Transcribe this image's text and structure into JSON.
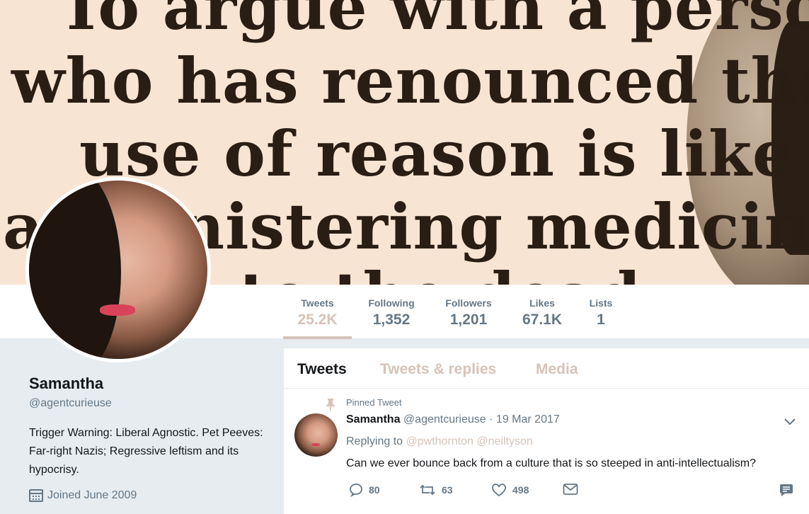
{
  "banner": {
    "lines": [
      "To argue with a person",
      "who has renounced the",
      "use of reason is like",
      "administering medicine",
      "to the dead"
    ]
  },
  "nav": {
    "stats": [
      {
        "label": "Tweets",
        "value": "25.2K",
        "active": true
      },
      {
        "label": "Following",
        "value": "1,352"
      },
      {
        "label": "Followers",
        "value": "1,201"
      },
      {
        "label": "Likes",
        "value": "67.1K"
      },
      {
        "label": "Lists",
        "value": "1"
      }
    ]
  },
  "profile": {
    "name": "Samantha",
    "handle": "@agentcurieuse",
    "bio": "Trigger Warning: Liberal Agnostic. Pet Peeves: Far-right Nazis; Regressive leftism and its hypocrisy.",
    "joined": "Joined June 2009",
    "joined_icon": "calendar-icon"
  },
  "timeline": {
    "tabs": [
      "Tweets",
      "Tweets & replies",
      "Media"
    ],
    "active_tab": "Tweets",
    "tweet": {
      "pinned_label": "Pinned Tweet",
      "name": "Samantha",
      "handle": "@agentcurieuse",
      "separator": "·",
      "time": "19 Mar 2017",
      "replying_prefix": "Replying to",
      "mentions": [
        "@pwthornton",
        "@neiltyson"
      ],
      "text": "Can we ever bounce back from a culture that is so steeped in anti-intellectualism?",
      "actions": {
        "reply_count": "80",
        "retweet_count": "63",
        "like_count": "498"
      }
    }
  },
  "colors": {
    "accent": "#d6c3b9",
    "text_primary": "#14171a",
    "text_secondary": "#657786",
    "page_bg": "#e6ecf0",
    "banner_bg": "#f7e4d2"
  }
}
